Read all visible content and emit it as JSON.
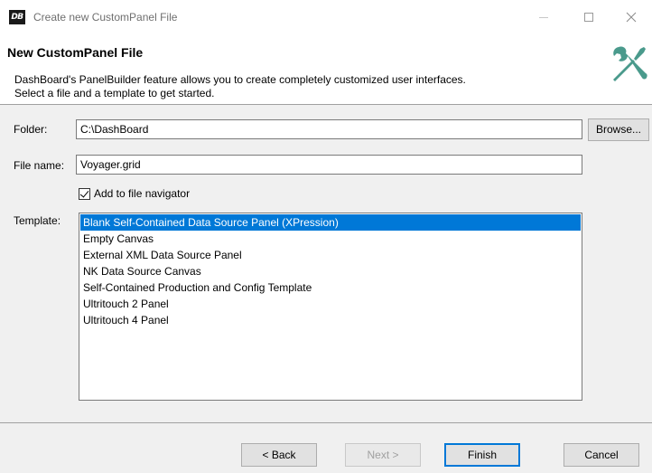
{
  "window": {
    "app_icon_text": "DB",
    "title": "Create new CustomPanel File"
  },
  "header": {
    "title": "New CustomPanel File",
    "description_line1": "DashBoard's PanelBuilder feature allows you to create completely customized user interfaces.",
    "description_line2": "Select a file and a template to get started.",
    "icon": "tools-icon"
  },
  "form": {
    "folder_label": "Folder:",
    "folder_value": "C:\\DashBoard",
    "browse_label": "Browse...",
    "filename_label": "File name:",
    "filename_value": "Voyager.grid",
    "add_to_navigator_label": "Add to file navigator",
    "add_to_navigator_checked": true,
    "template_label": "Template:",
    "templates": [
      {
        "label": "Blank Self-Contained Data Source Panel (XPression)",
        "selected": true
      },
      {
        "label": "Empty Canvas",
        "selected": false
      },
      {
        "label": "External XML Data Source Panel",
        "selected": false
      },
      {
        "label": "NK Data Source Canvas",
        "selected": false
      },
      {
        "label": "Self-Contained Production and Config Template",
        "selected": false
      },
      {
        "label": "Ultritouch 2 Panel",
        "selected": false
      },
      {
        "label": "Ultritouch 4 Panel",
        "selected": false
      }
    ]
  },
  "footer": {
    "back_label": "< Back",
    "next_label": "Next >",
    "finish_label": "Finish",
    "cancel_label": "Cancel"
  },
  "colors": {
    "selection": "#0078d7",
    "dialog_bg": "#f0f0f0",
    "icon_teal": "#4a9a8c"
  }
}
